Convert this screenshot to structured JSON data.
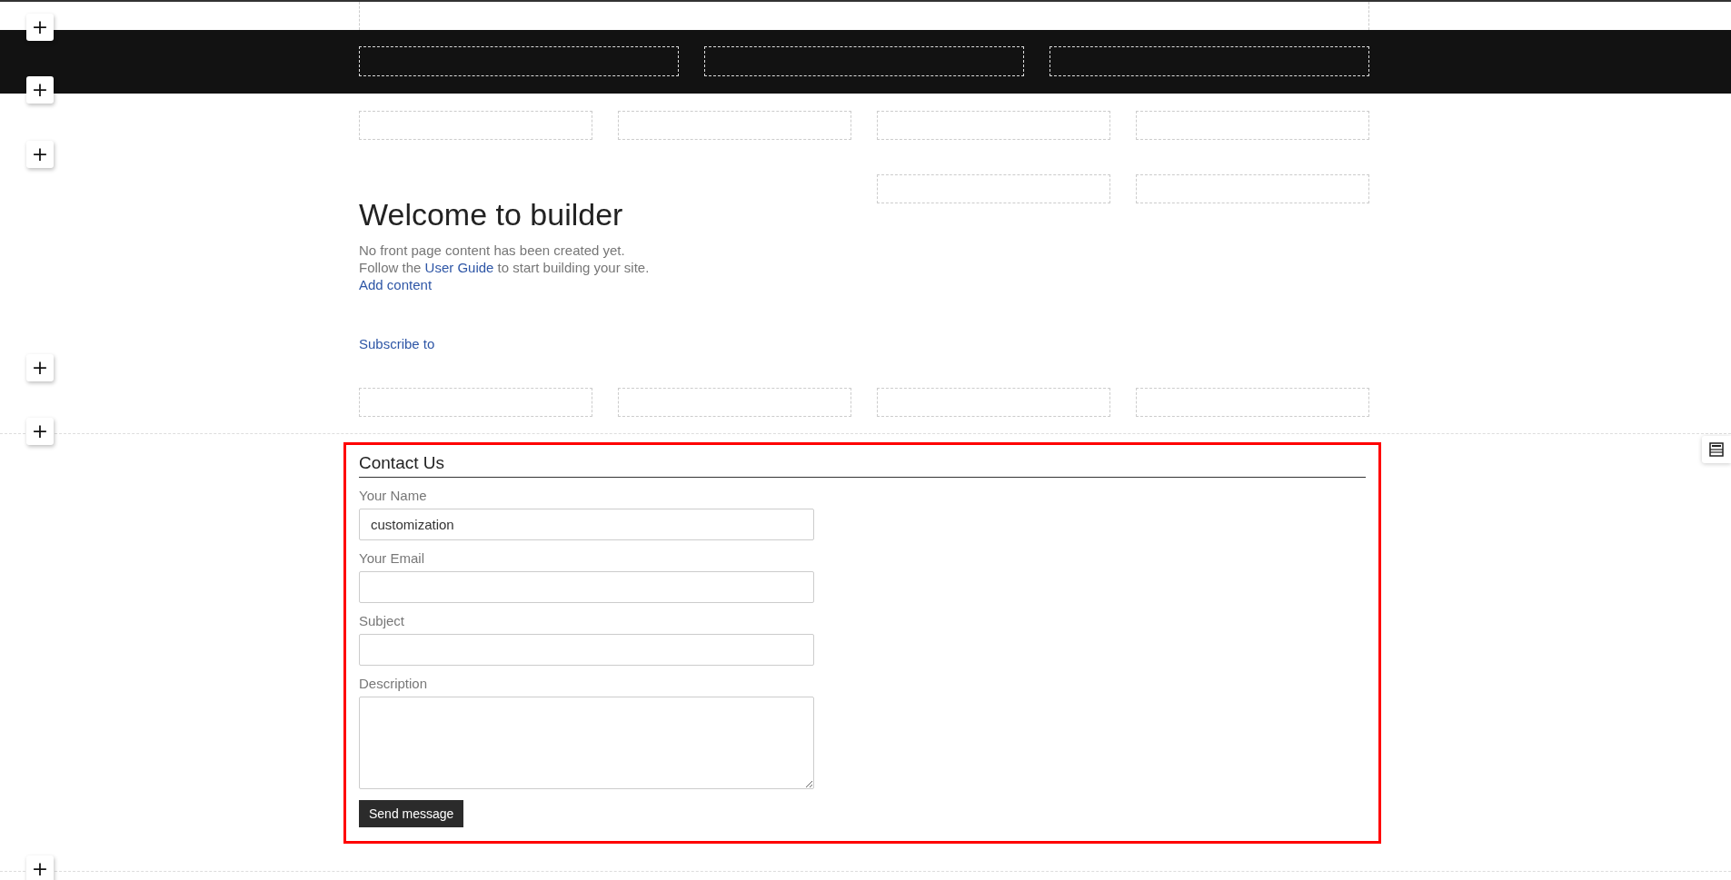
{
  "add_buttons": [
    "+",
    "+",
    "+",
    "+",
    "+",
    "+"
  ],
  "welcome": {
    "title": "Welcome to builder",
    "line_1": "No front page content has been created yet.",
    "line_2": {
      "before": "Follow the ",
      "link": "User Guide",
      "after": " to start building your site."
    },
    "add_link": "Add content"
  },
  "subscribe_link": "Subscribe to",
  "contact": {
    "title": "Contact Us",
    "fields": [
      {
        "label": "Your Name",
        "kind": "input",
        "value": "customization"
      },
      {
        "label": "Your Email",
        "kind": "input"
      },
      {
        "label": "Subject",
        "kind": "input"
      },
      {
        "label": "Description",
        "kind": "textarea"
      }
    ],
    "button": "Send message"
  }
}
